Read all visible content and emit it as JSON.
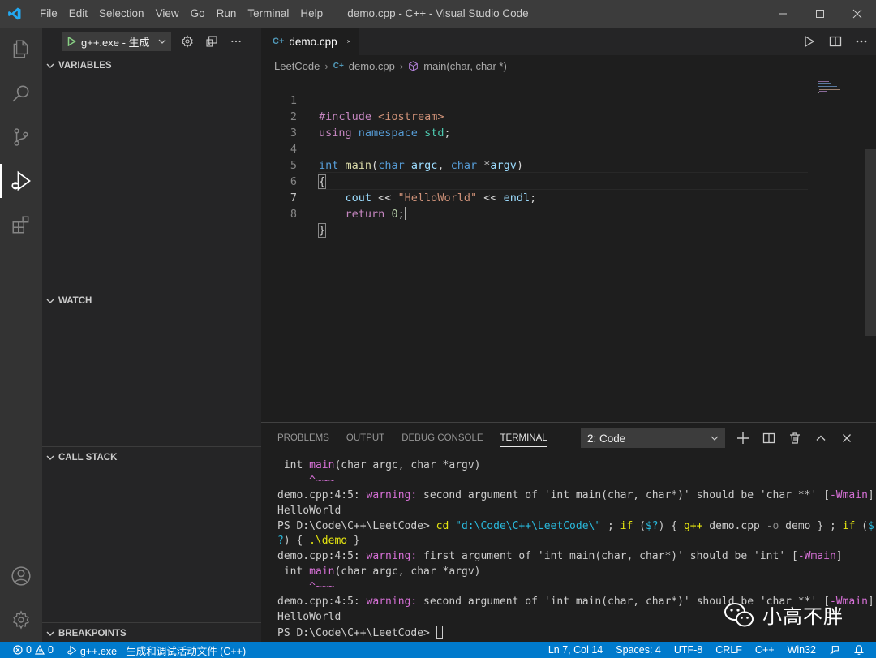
{
  "window": {
    "title": "demo.cpp - C++ - Visual Studio Code",
    "menu": [
      "File",
      "Edit",
      "Selection",
      "View",
      "Go",
      "Run",
      "Terminal",
      "Help"
    ]
  },
  "debug": {
    "config_label": "g++.exe - 生成",
    "sections": {
      "variables": "VARIABLES",
      "watch": "WATCH",
      "call_stack": "CALL STACK",
      "breakpoints": "BREAKPOINTS"
    }
  },
  "editor": {
    "tab_name": "demo.cpp",
    "breadcrumb": [
      "LeetCode",
      "demo.cpp",
      "main(char, char *)"
    ],
    "line_numbers": [
      "1",
      "2",
      "3",
      "4",
      "5",
      "6",
      "7",
      "8"
    ]
  },
  "panel": {
    "tabs": [
      "PROBLEMS",
      "OUTPUT",
      "DEBUG CONSOLE",
      "TERMINAL"
    ],
    "active_tab": "TERMINAL",
    "terminal_select": "2: Code"
  },
  "watermark": "小高不胖",
  "statusbar": {
    "errors": "0",
    "warnings": "0",
    "debug_target": "g++.exe - 生成和调试活动文件 (C++)",
    "position": "Ln 7, Col 14",
    "spaces": "Spaces: 4",
    "encoding": "UTF-8",
    "eol": "CRLF",
    "language": "C++",
    "platform": "Win32"
  },
  "colors": {
    "accent": "#007acc",
    "titlebar": "#3c3c3c",
    "activitybar": "#333333",
    "sidebar": "#252526",
    "editor_bg": "#1e1e1e"
  },
  "icons": [
    "vscode-logo-icon",
    "explorer-icon",
    "search-icon",
    "source-control-icon",
    "run-debug-icon",
    "extensions-icon",
    "account-icon",
    "settings-gear-icon"
  ]
}
